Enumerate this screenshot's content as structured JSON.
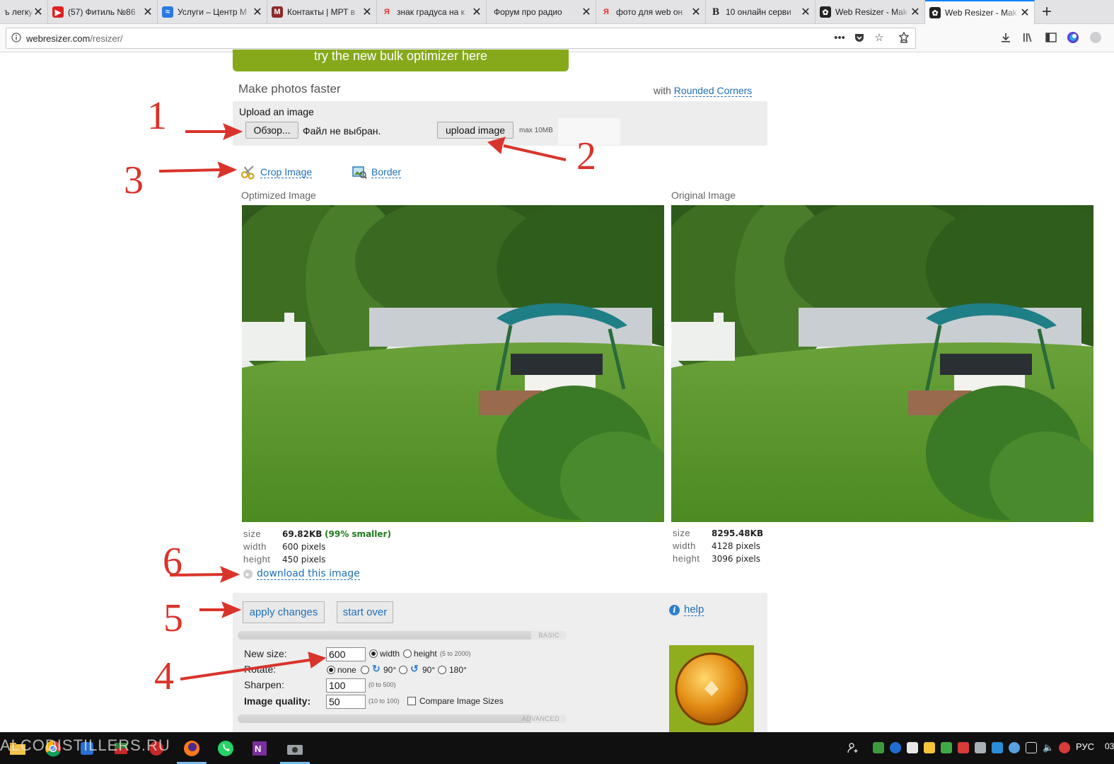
{
  "browser": {
    "tabs": [
      {
        "title": "ъ легку",
        "favicon_color": "#e3e3e5",
        "favicon_text": ""
      },
      {
        "title": "(57) Фитиль №86",
        "favicon_color": "#e02020",
        "favicon_text": "▶"
      },
      {
        "title": "Услуги – Центр М",
        "favicon_color": "#2a7ae2",
        "favicon_text": "≈"
      },
      {
        "title": "Контакты | МРТ в",
        "favicon_color": "#8b2a2a",
        "favicon_text": "M"
      },
      {
        "title": "знак градуса на к",
        "favicon_color": "#ffffff",
        "favicon_text": "Я"
      },
      {
        "title": "Форум про радио",
        "favicon_color": "#e3e3e5",
        "favicon_text": ""
      },
      {
        "title": "фото для web он",
        "favicon_color": "#ffffff",
        "favicon_text": "Я"
      },
      {
        "title": "10 онлайн серви",
        "favicon_color": "#ffffff",
        "favicon_text": "B"
      },
      {
        "title": "Web Resizer - Mak",
        "favicon_color": "#222222",
        "favicon_text": "✿"
      },
      {
        "title": "Web Resizer - Mak",
        "favicon_color": "#222222",
        "favicon_text": "✿"
      }
    ],
    "close_glyph": "✕",
    "new_tab_glyph": "+",
    "url_host": "webresizer.com",
    "url_path": "/resizer/",
    "accent": "#0a84ff"
  },
  "page": {
    "banner": "try the new bulk optimizer here",
    "headline": "Make photos faster",
    "with_prefix": "with",
    "rounded_corners_link": "Rounded Corners",
    "upload": {
      "label": "Upload an image",
      "browse_button": "Обзор...",
      "no_file": "Файл не выбран.",
      "upload_button": "upload image",
      "max": "max 10MB"
    },
    "tools": {
      "crop": "Crop Image",
      "border": "Border"
    },
    "optimized": {
      "label": "Optimized Image",
      "size_key": "size",
      "size_value": "69.82KB",
      "smaller": "(99% smaller)",
      "width_key": "width",
      "width_value": "600 pixels",
      "height_key": "height",
      "height_value": "450 pixels",
      "download": "download this image"
    },
    "original": {
      "label": "Original Image",
      "size_key": "size",
      "size_value": "8295.48KB",
      "width_key": "width",
      "width_value": "4128 pixels",
      "height_key": "height",
      "height_value": "3096 pixels"
    },
    "settings": {
      "apply": "apply changes",
      "start_over": "start over",
      "help": "help",
      "basic": "BASIC",
      "advanced": "ADVANCED",
      "new_size_label": "New size:",
      "new_size_value": "600",
      "width_opt": "width",
      "height_opt": "height",
      "size_range": "(5 to 2000)",
      "rotate_label": "Rotate:",
      "rotate_none": "none",
      "rotate_cw": "90°",
      "rotate_ccw": "90°",
      "rotate_180": "180°",
      "sharpen_label": "Sharpen:",
      "sharpen_value": "100",
      "sharpen_range": "(0 to 500)",
      "quality_label": "Image quality:",
      "quality_value": "50",
      "quality_range": "(10 to 100)",
      "compare_label": "Compare Image Sizes"
    },
    "annotations": [
      "1",
      "2",
      "3",
      "4",
      "5",
      "6"
    ],
    "annotation_color": "#d9342b"
  },
  "taskbar": {
    "watermark": "ALCODISTILLERS.RU",
    "lang": "РУС",
    "clock": "03"
  }
}
